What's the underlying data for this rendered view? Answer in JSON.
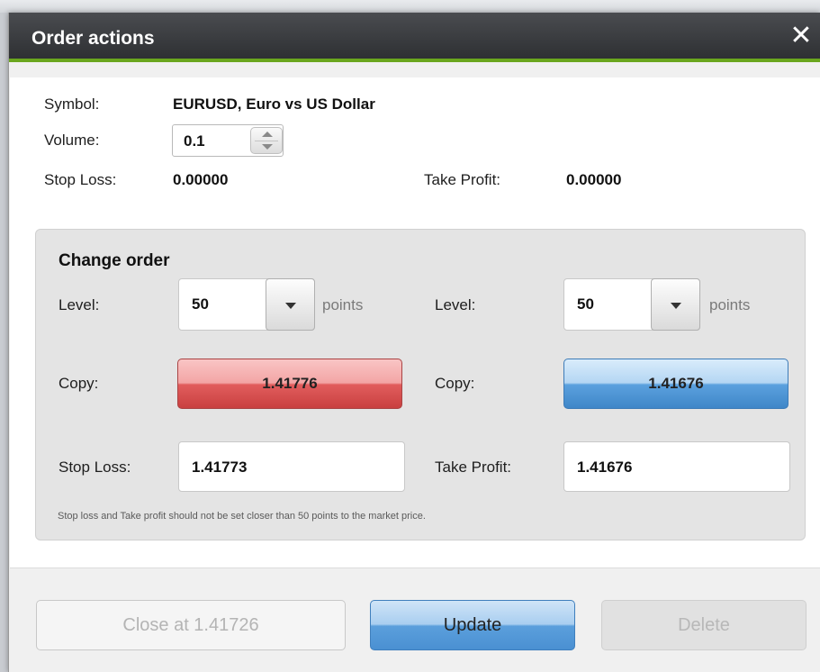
{
  "dialog": {
    "title": "Order actions",
    "close_glyph": "✕"
  },
  "order": {
    "symbol_label": "Symbol:",
    "symbol_value": "EURUSD, Euro vs US Dollar",
    "volume_label": "Volume:",
    "volume_value": "0.1",
    "stop_loss_label": "Stop Loss:",
    "stop_loss_value": "0.00000",
    "take_profit_label": "Take Profit:",
    "take_profit_value": "0.00000"
  },
  "change_order": {
    "title": "Change order",
    "stop_loss": {
      "level_label": "Level:",
      "level_value": "50",
      "unit": "points",
      "copy_label": "Copy:",
      "copy_value": "1.41776",
      "field_label": "Stop Loss:",
      "field_value": "1.41773"
    },
    "take_profit": {
      "level_label": "Level:",
      "level_value": "50",
      "unit": "points",
      "copy_label": "Copy:",
      "copy_value": "1.41676",
      "field_label": "Take Profit:",
      "field_value": "1.41676"
    },
    "note": "Stop loss and Take profit should not be set closer than 50 points to the market price."
  },
  "footer": {
    "close_label": "Close at 1.41726",
    "update_label": "Update",
    "delete_label": "Delete"
  },
  "colors": {
    "accent_green": "#6aa61e",
    "sell_red": "#e15d5d",
    "buy_blue": "#5b9fdc"
  },
  "icons": {
    "close": "close-icon",
    "spin_up": "chevron-up-icon",
    "spin_down": "chevron-down-icon",
    "dropdown": "caret-down-icon"
  }
}
